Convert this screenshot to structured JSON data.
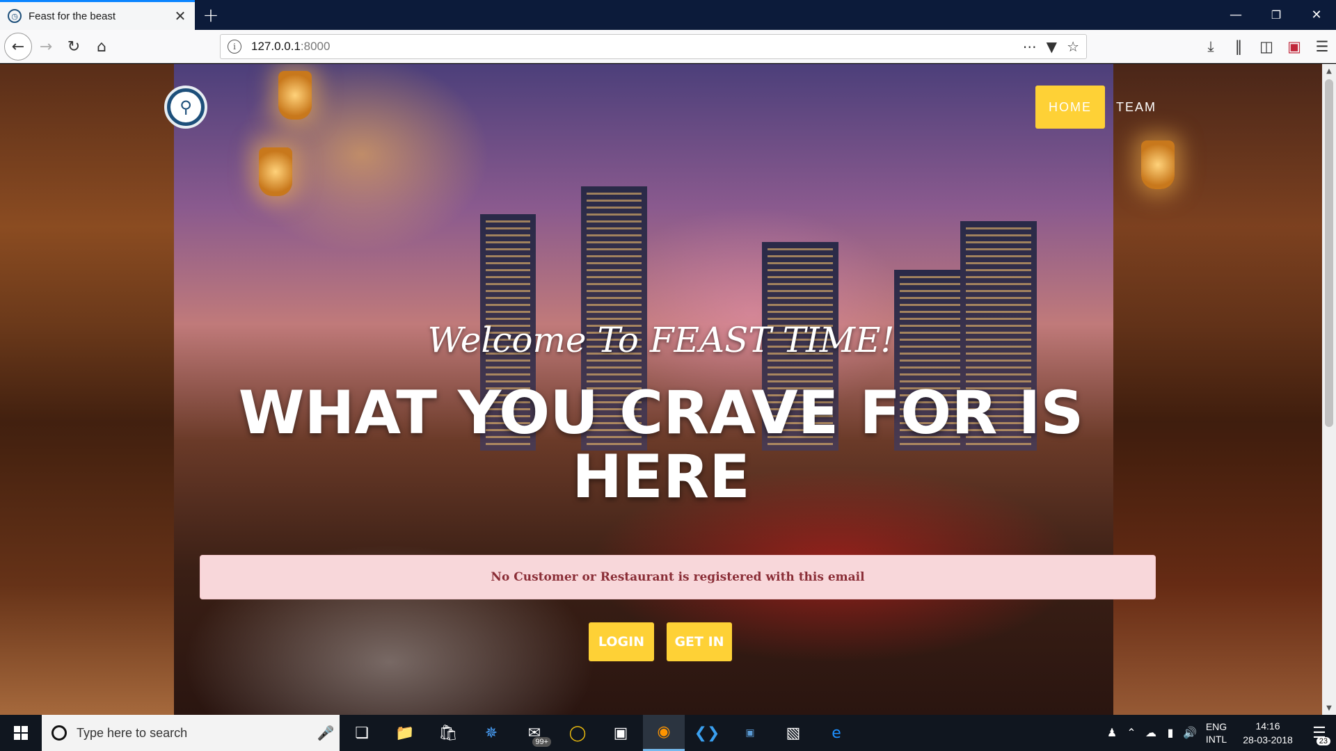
{
  "browser": {
    "tab_title": "Feast for the beast",
    "url_host": "127.0.0.1",
    "url_port": ":8000"
  },
  "site": {
    "nav": {
      "home": "HOME",
      "team": "TEAM"
    },
    "welcome": "Welcome To FEAST TIME!",
    "headline": "WHAT YOU CRAVE FOR IS HERE",
    "alert": "No Customer or Restaurant is registered with this email",
    "buttons": {
      "login": "LOGIN",
      "get_in": "GET IN"
    },
    "accent_color": "#fed136"
  },
  "taskbar": {
    "search_placeholder": "Type here to search",
    "mail_badge": "99+",
    "lang_line1": "ENG",
    "lang_line2": "INTL",
    "time": "14:16",
    "date": "28-03-2018",
    "notifications": "23"
  }
}
